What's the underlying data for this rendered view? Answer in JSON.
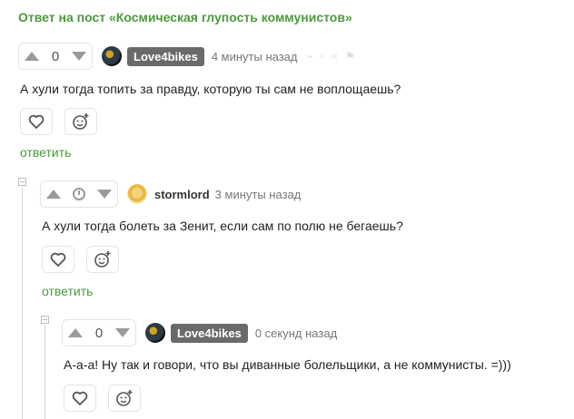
{
  "post_link": "Ответ на пост «Космическая глупость коммунистов»",
  "comments": [
    {
      "rating": "0",
      "username": "Love4bikes",
      "time": "4 минуты назад",
      "text": "А хули тогда топить за правду, которую ты сам не воплощаешь?",
      "reply": "ответить"
    },
    {
      "rating": "",
      "username": "stormlord",
      "time": "3 минуты назад",
      "text": "А хули тогда болеть за Зенит, если сам по полю не бегаешь?",
      "reply": "ответить"
    },
    {
      "rating": "0",
      "username": "Love4bikes",
      "time": "0 секунд назад",
      "text": "А-а-а! Ну так и говори, что вы диванные болельщики, а не коммунисты. =)))"
    }
  ],
  "icons": {
    "upvote": "upvote-icon",
    "downvote": "downvote-icon",
    "like": "heart-icon",
    "react": "emoji-plus-icon",
    "pending": "clock-icon",
    "collapse": "collapse-icon"
  },
  "colors": {
    "link_green": "#4a9a3c",
    "badge_gray": "#6a6a6a",
    "icon_gray": "#9a9a9a"
  }
}
